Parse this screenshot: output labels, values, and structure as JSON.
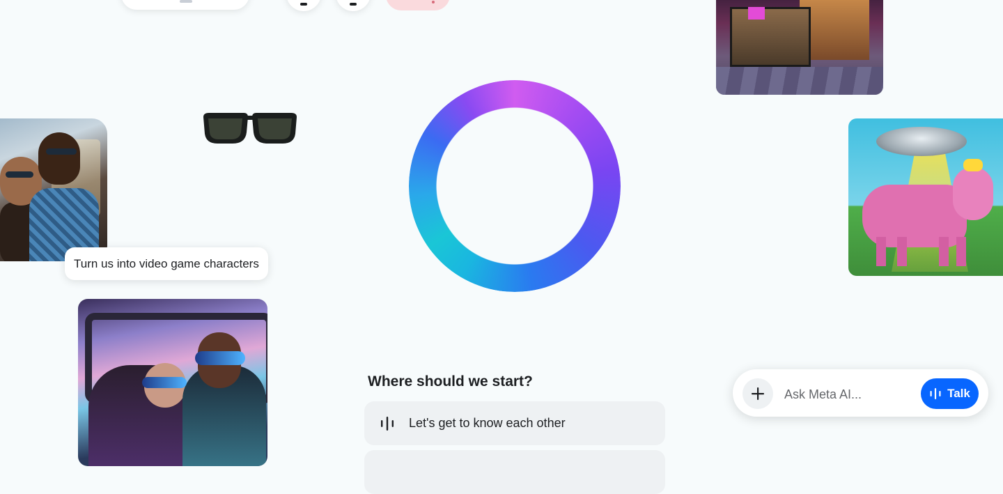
{
  "prompt_bubble": {
    "text": "Turn us into video game characters"
  },
  "start": {
    "title": "Where should we start?",
    "suggestions": [
      {
        "label": "Let's get to know each other",
        "icon": "voice-bars-icon"
      }
    ]
  },
  "ask_bar": {
    "add_icon": "plus-icon",
    "placeholder": "Ask Meta AI...",
    "talk_label": "Talk",
    "talk_icon": "voice-bars-icon"
  },
  "colors": {
    "background": "#f7fbfc",
    "accent_blue": "#0866ff",
    "suggestion_bg": "#eef1f3",
    "pink_pill": "#fadadd"
  }
}
